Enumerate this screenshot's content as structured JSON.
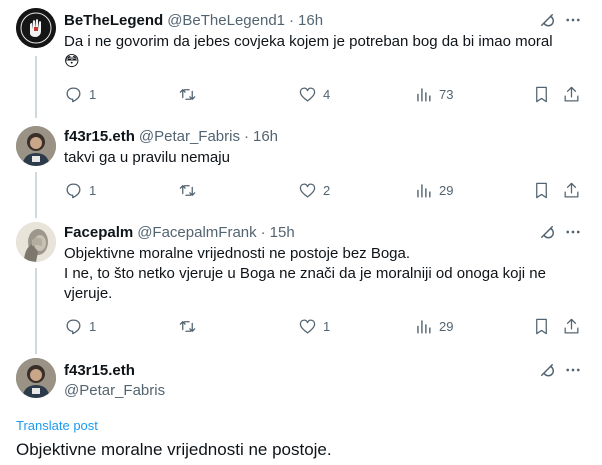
{
  "tweets": [
    {
      "name": "BeTheLegend",
      "handle": "@BeTheLegend1",
      "time": "16h",
      "text": "Da i ne govorim da jebes covjeka kojem je potreban bog da bi imao moral",
      "emoji": "😳",
      "replies": "1",
      "reposts": "",
      "likes": "4",
      "views": "73"
    },
    {
      "name": "f43r15.eth",
      "handle": "@Petar_Fabris",
      "time": "16h",
      "text": "takvi ga u pravilu nemaju",
      "replies": "1",
      "reposts": "",
      "likes": "2",
      "views": "29"
    },
    {
      "name": "Facepalm",
      "handle": "@FacepalmFrank",
      "time": "15h",
      "lines": [
        "Objektivne moralne vrijednosti ne postoje bez Boga.",
        "I ne, to što netko vjeruje u Boga ne znači da je moralniji od onoga koji ne",
        "vjeruje."
      ],
      "replies": "1",
      "reposts": "",
      "likes": "1",
      "views": "29"
    }
  ],
  "main": {
    "name": "f43r15.eth",
    "handle": "@Petar_Fabris",
    "translate": "Translate post",
    "text": "Objektivne moralne vrijednosti ne postoje."
  },
  "separator": "·",
  "colors": {
    "text": "#0f1419",
    "muted": "#536471",
    "link": "#1d9bf0",
    "line": "#cfd9de"
  }
}
